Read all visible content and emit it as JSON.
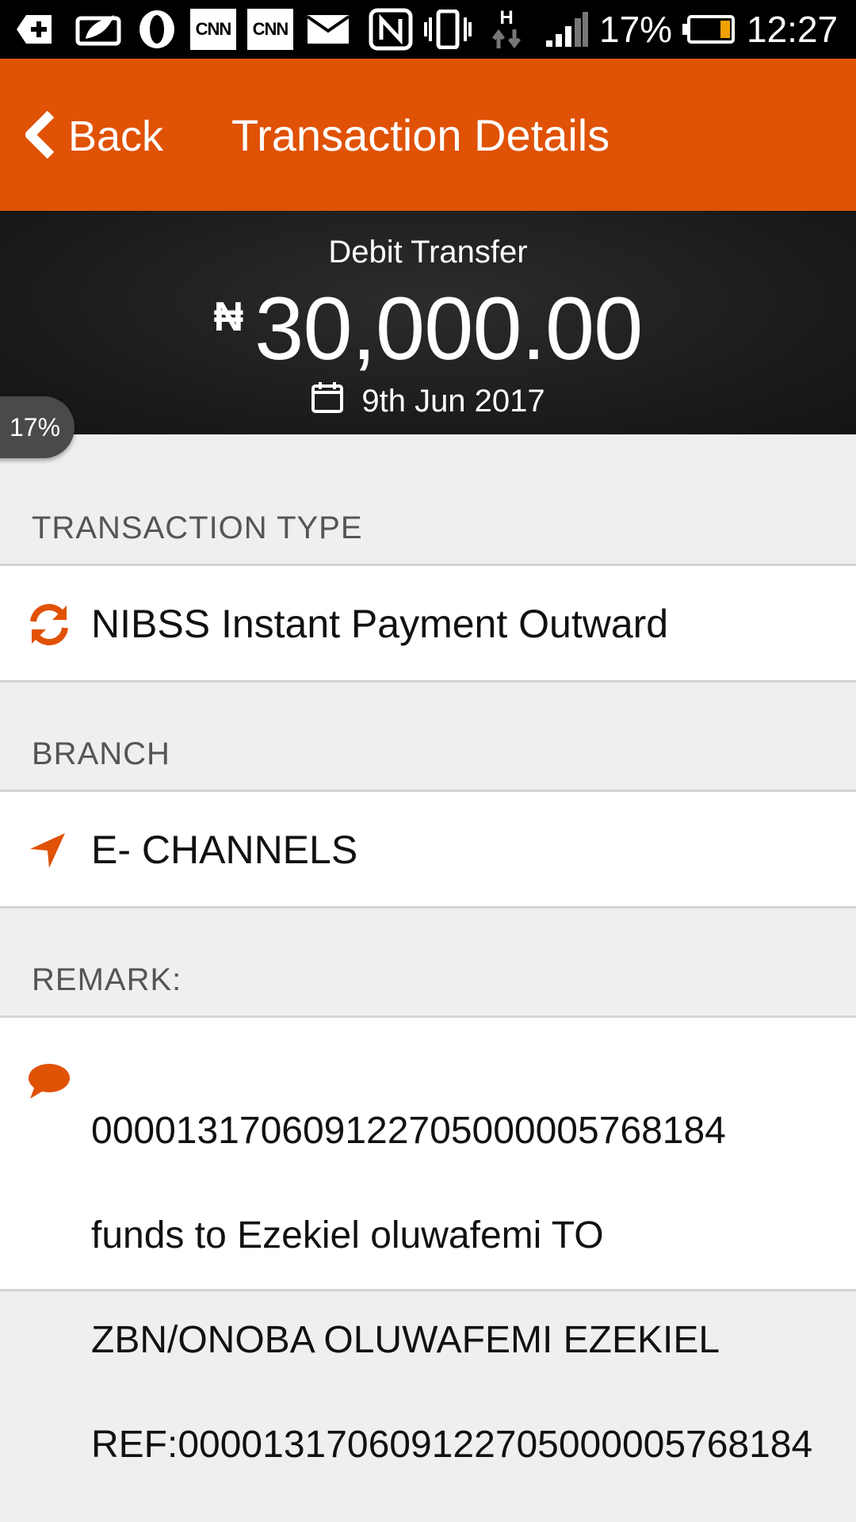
{
  "status_bar": {
    "battery_percent": "17%",
    "time": "12:27",
    "cnn_label": "CNN",
    "network_label": "H",
    "icons": [
      "add-notification-icon",
      "leaf-icon",
      "opera-icon",
      "cnn-icon",
      "cnn-icon",
      "mail-icon",
      "nfc-icon",
      "vibrate-icon",
      "network-h-icon",
      "signal-icon",
      "battery-icon"
    ]
  },
  "header": {
    "back_label": "Back",
    "title": "Transaction Details"
  },
  "summary": {
    "type": "Debit Transfer",
    "currency_symbol": "₦",
    "amount": "30,000.00",
    "date": "9th Jun 2017"
  },
  "overlay_badge": "17%",
  "sections": {
    "transaction_type": {
      "label": "TRANSACTION TYPE",
      "value": "NIBSS Instant Payment Outward"
    },
    "branch": {
      "label": "BRANCH",
      "value": "E- CHANNELS"
    },
    "remark": {
      "label": "REMARK:",
      "lines": [
        "000013170609122705000005768184",
        "funds to Ezekiel oluwafemi TO",
        "ZBN/ONOBA OLUWAFEMI EZEKIEL",
        "REF:000013170609122705000005768184"
      ]
    }
  },
  "colors": {
    "accent": "#e05206",
    "summary_bg": "#1a1a1a",
    "page_bg": "#efefef"
  }
}
